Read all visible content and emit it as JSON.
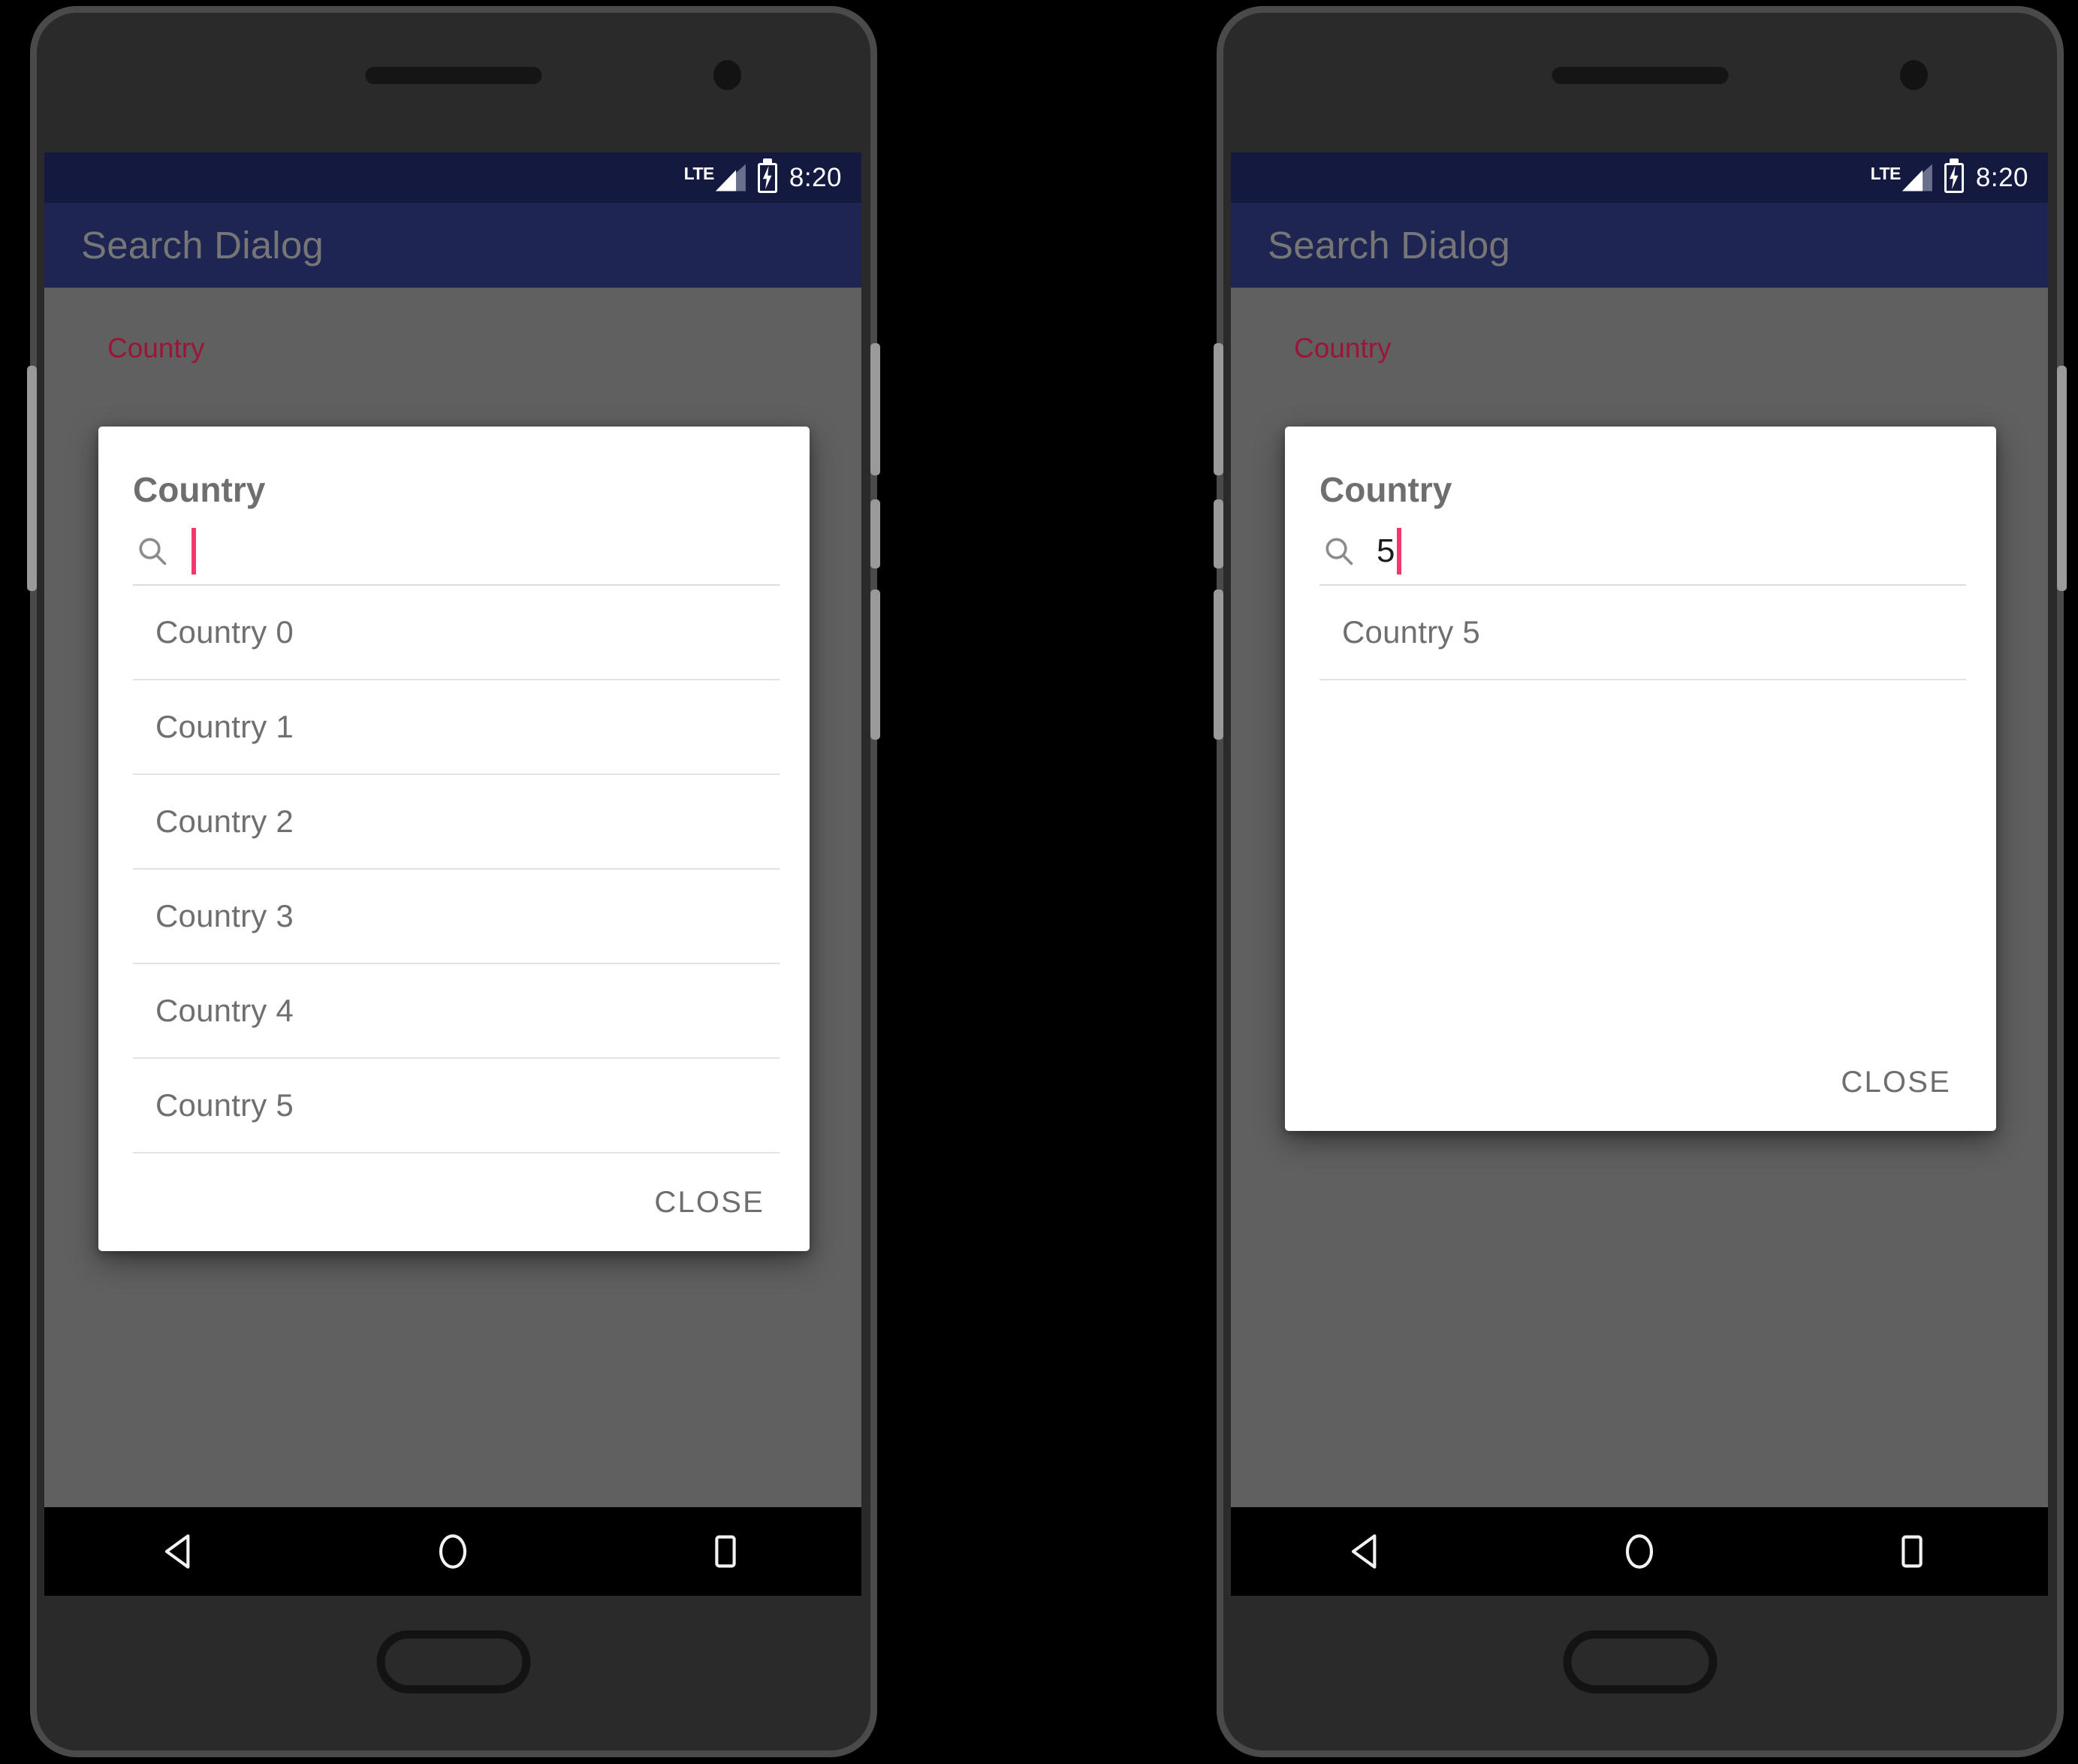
{
  "status_bar": {
    "network_label": "LTE",
    "time": "8:20",
    "battery_icon": "battery-charging-icon",
    "signal_icon": "signal-bars-icon",
    "background_color": "#141a3f"
  },
  "app_bar": {
    "title": "Search Dialog",
    "background_color": "#1e2553",
    "title_color": "#767676"
  },
  "screen": {
    "scrim_color": "#606060",
    "field_label": "Country",
    "field_label_color": "#9b1538"
  },
  "dialog": {
    "title": "Country",
    "search": {
      "icon": "search-icon",
      "placeholder": "",
      "caret_color": "#f5356e"
    },
    "close_label": "CLOSE"
  },
  "nav_bar": {
    "back_icon": "back-triangle-icon",
    "home_icon": "home-circle-icon",
    "recents_icon": "recents-square-icon",
    "background_color": "#000000"
  },
  "phones": [
    {
      "id": "left",
      "search_value": "",
      "list_items": [
        "Country 0",
        "Country 1",
        "Country 2",
        "Country 3",
        "Country 4",
        "Country 5"
      ]
    },
    {
      "id": "right",
      "search_value": "5",
      "list_items": [
        "Country 5"
      ]
    }
  ]
}
